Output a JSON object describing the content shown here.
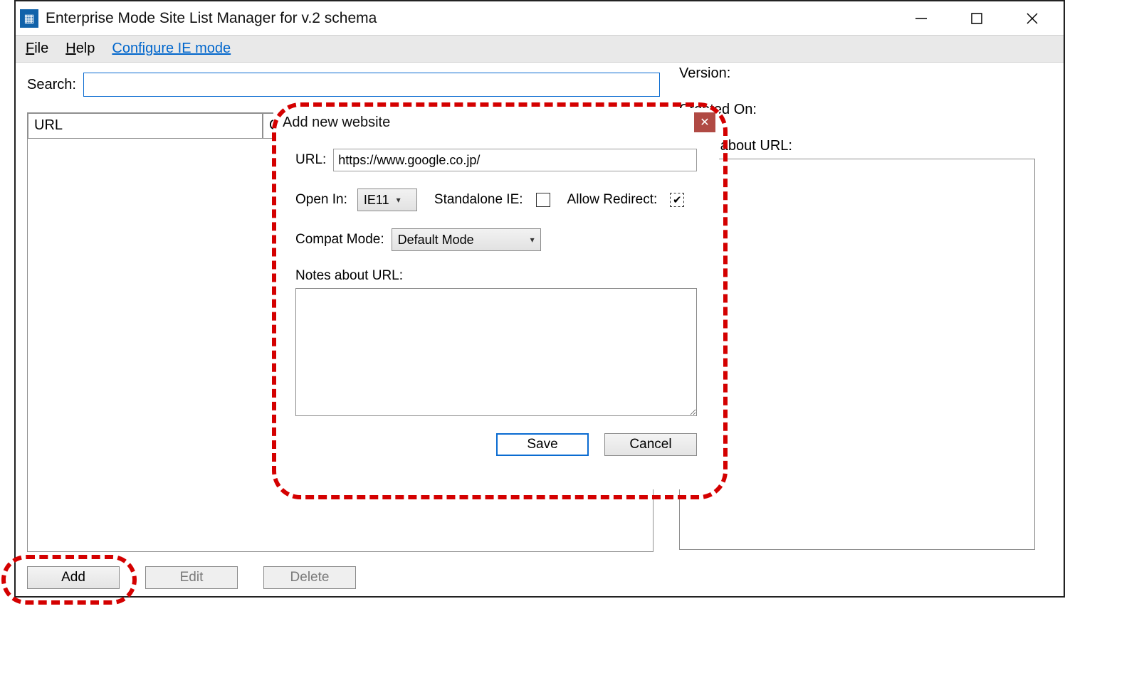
{
  "window": {
    "title": "Enterprise Mode Site List Manager for v.2 schema"
  },
  "menu": {
    "file": "File",
    "help": "Help",
    "configure": "Configure IE mode"
  },
  "main": {
    "search_label": "Search:",
    "search_value": "",
    "version_label": "Version:",
    "created_label": "Created On:",
    "notes_panel_label": "Notes about URL:",
    "columns": {
      "url": "URL",
      "open": "Open In"
    },
    "buttons": {
      "add": "Add",
      "edit": "Edit",
      "delete": "Delete"
    }
  },
  "dialog": {
    "title": "Add new website",
    "url_label": "URL:",
    "url_value": "https://www.google.co.jp/",
    "open_in_label": "Open In:",
    "open_in_value": "IE11",
    "standalone_label": "Standalone IE:",
    "standalone_checked": false,
    "allow_redirect_label": "Allow Redirect:",
    "allow_redirect_checked": true,
    "compat_label": "Compat Mode:",
    "compat_value": "Default Mode",
    "notes_label": "Notes about URL:",
    "notes_value": "",
    "save": "Save",
    "cancel": "Cancel"
  }
}
